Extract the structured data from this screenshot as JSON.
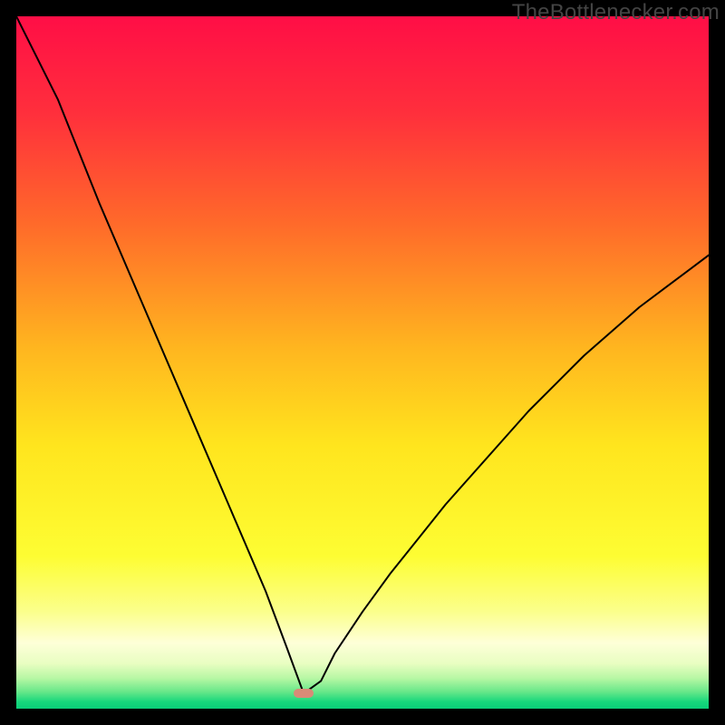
{
  "watermark": "TheBottlenecker.com",
  "marker": {
    "color": "#d88b77",
    "x_pct": 41.5,
    "y_pct": 97.8
  },
  "gradient_stops": [
    {
      "offset": 0,
      "color": "#ff0e46"
    },
    {
      "offset": 0.14,
      "color": "#ff2f3c"
    },
    {
      "offset": 0.3,
      "color": "#ff6a2a"
    },
    {
      "offset": 0.48,
      "color": "#ffb61f"
    },
    {
      "offset": 0.62,
      "color": "#ffe51e"
    },
    {
      "offset": 0.78,
      "color": "#fdfd33"
    },
    {
      "offset": 0.86,
      "color": "#fbff8c"
    },
    {
      "offset": 0.905,
      "color": "#feffd8"
    },
    {
      "offset": 0.935,
      "color": "#e8fec1"
    },
    {
      "offset": 0.956,
      "color": "#b7f7a4"
    },
    {
      "offset": 0.975,
      "color": "#6ae88a"
    },
    {
      "offset": 0.99,
      "color": "#17d77c"
    },
    {
      "offset": 1.0,
      "color": "#0acd78"
    }
  ],
  "chart_data": {
    "type": "line",
    "title": "",
    "xlabel": "",
    "ylabel": "",
    "xlim": [
      0,
      100
    ],
    "ylim": [
      0,
      100
    ],
    "note": "V-shaped bottleneck curve; y is bottleneck %, minimum at the marker. Values estimated from pixels.",
    "x": [
      0,
      3,
      6,
      9,
      12,
      15,
      18,
      21,
      24,
      27,
      30,
      33,
      36,
      39,
      41.5,
      44,
      46,
      50,
      54,
      58,
      62,
      66,
      70,
      74,
      78,
      82,
      86,
      90,
      94,
      98,
      100
    ],
    "y": [
      100,
      94,
      88,
      80.5,
      73,
      66,
      59,
      52,
      45,
      38,
      31,
      24,
      17,
      9,
      2.2,
      4,
      8,
      14,
      19.5,
      24.5,
      29.5,
      34,
      38.5,
      43,
      47,
      51,
      54.5,
      58,
      61,
      64,
      65.5
    ],
    "marker_point": {
      "x": 41.5,
      "y": 2.2
    }
  }
}
